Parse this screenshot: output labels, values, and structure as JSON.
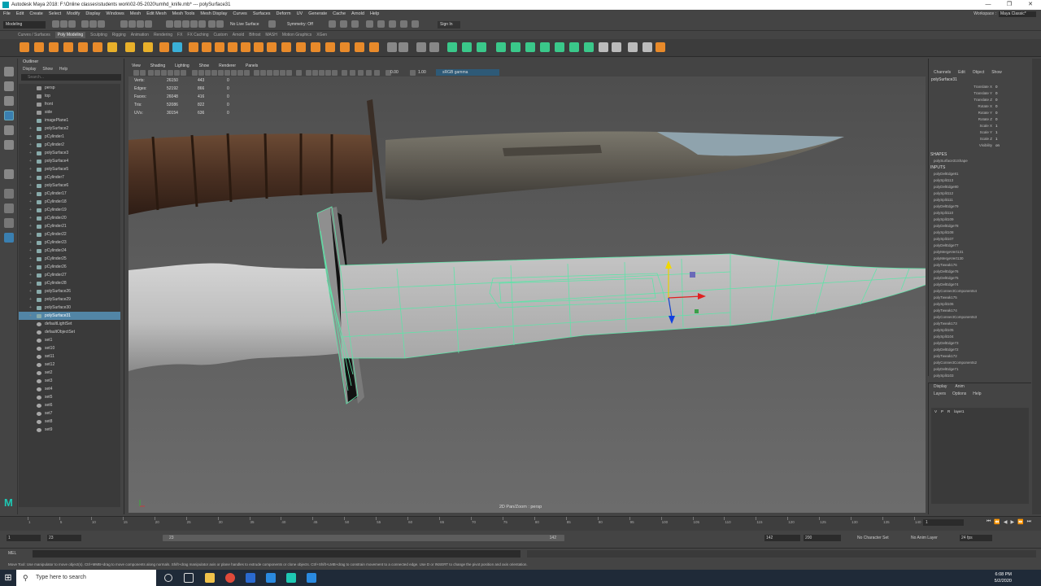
{
  "title_bar": {
    "text": "Autodesk Maya 2018: F:\\Online classes\\students work\\02-05-2020\\umhd_knife.mb* --- polySurface31",
    "buttons": [
      "—",
      "❐",
      "✕"
    ]
  },
  "menu": [
    "File",
    "Edit",
    "Create",
    "Select",
    "Modify",
    "Display",
    "Windows",
    "Mesh",
    "Edit Mesh",
    "Mesh Tools",
    "Mesh Display",
    "Curves",
    "Surfaces",
    "Deform",
    "UV",
    "Generate",
    "Cache",
    "Arnold",
    "Help"
  ],
  "workspace": {
    "label": "Workspace :",
    "value": "Maya Classic*"
  },
  "status_line": {
    "mode": "Modeling",
    "live_surface": "No Live Surface",
    "symmetry": "Symmetry: Off",
    "signin": "Sign In"
  },
  "shelf_tabs": [
    "Curves / Surfaces",
    "Poly Modeling",
    "Sculpting",
    "Rigging",
    "Animation",
    "Rendering",
    "FX",
    "FX Caching",
    "Custom",
    "Arnold",
    "Bifrost",
    "MASH",
    "Motion Graphics",
    "XGen"
  ],
  "shelf_active": "Poly Modeling",
  "outliner": {
    "title": "Outliner",
    "menu": [
      "Display",
      "Show",
      "Help"
    ],
    "search_placeholder": "Search...",
    "items": [
      {
        "label": "persp",
        "type": "cam"
      },
      {
        "label": "top",
        "type": "cam"
      },
      {
        "label": "front",
        "type": "cam"
      },
      {
        "label": "side",
        "type": "cam"
      },
      {
        "label": "imagePlane1",
        "type": "mesh"
      },
      {
        "label": "polySurface2",
        "type": "mesh"
      },
      {
        "label": "pCylinder1",
        "type": "mesh"
      },
      {
        "label": "pCylinder2",
        "type": "mesh"
      },
      {
        "label": "polySurface3",
        "type": "mesh"
      },
      {
        "label": "polySurface4",
        "type": "mesh"
      },
      {
        "label": "polySurface5",
        "type": "mesh"
      },
      {
        "label": "pCylinder7",
        "type": "mesh"
      },
      {
        "label": "polySurface6",
        "type": "mesh"
      },
      {
        "label": "pCylinder17",
        "type": "mesh"
      },
      {
        "label": "pCylinder18",
        "type": "mesh"
      },
      {
        "label": "pCylinder19",
        "type": "mesh"
      },
      {
        "label": "pCylinder20",
        "type": "mesh"
      },
      {
        "label": "pCylinder21",
        "type": "mesh"
      },
      {
        "label": "pCylinder22",
        "type": "mesh"
      },
      {
        "label": "pCylinder23",
        "type": "mesh"
      },
      {
        "label": "pCylinder24",
        "type": "mesh"
      },
      {
        "label": "pCylinder25",
        "type": "mesh"
      },
      {
        "label": "pCylinder26",
        "type": "mesh"
      },
      {
        "label": "pCylinder27",
        "type": "mesh"
      },
      {
        "label": "pCylinder28",
        "type": "mesh"
      },
      {
        "label": "polySurface26",
        "type": "mesh"
      },
      {
        "label": "polySurface29",
        "type": "mesh"
      },
      {
        "label": "polySurface30",
        "type": "mesh"
      },
      {
        "label": "polySurface31",
        "type": "mesh",
        "selected": true
      },
      {
        "label": "defaultLightSet",
        "type": "set"
      },
      {
        "label": "defaultObjectSet",
        "type": "set"
      },
      {
        "label": "set1",
        "type": "set"
      },
      {
        "label": "set10",
        "type": "set"
      },
      {
        "label": "set11",
        "type": "set"
      },
      {
        "label": "set12",
        "type": "set"
      },
      {
        "label": "set2",
        "type": "set"
      },
      {
        "label": "set3",
        "type": "set"
      },
      {
        "label": "set4",
        "type": "set"
      },
      {
        "label": "set5",
        "type": "set"
      },
      {
        "label": "set6",
        "type": "set"
      },
      {
        "label": "set7",
        "type": "set"
      },
      {
        "label": "set8",
        "type": "set"
      },
      {
        "label": "set9",
        "type": "set"
      }
    ]
  },
  "viewport": {
    "menu": [
      "View",
      "Shading",
      "Lighting",
      "Show",
      "Renderer",
      "Panels"
    ],
    "exposure": "0.00",
    "gamma": "1.00",
    "color_space": "sRGB gamma",
    "camera_label": "2D Pan/Zoom : persp",
    "hud": [
      {
        "label": "Verts:",
        "a": "26150",
        "b": "443",
        "c": "0"
      },
      {
        "label": "Edges:",
        "a": "52192",
        "b": "866",
        "c": "0"
      },
      {
        "label": "Faces:",
        "a": "26048",
        "b": "416",
        "c": "0"
      },
      {
        "label": "Tris:",
        "a": "52086",
        "b": "822",
        "c": "0"
      },
      {
        "label": "UVs:",
        "a": "30154",
        "b": "636",
        "c": "0"
      }
    ]
  },
  "channel_box": {
    "menu": [
      "Channels",
      "Edit",
      "Object",
      "Show"
    ],
    "object": "polySurface31",
    "attributes": [
      {
        "name": "Translate X",
        "value": "0"
      },
      {
        "name": "Translate Y",
        "value": "0"
      },
      {
        "name": "Translate Z",
        "value": "0"
      },
      {
        "name": "Rotate X",
        "value": "0"
      },
      {
        "name": "Rotate Y",
        "value": "0"
      },
      {
        "name": "Rotate Z",
        "value": "0"
      },
      {
        "name": "Scale X",
        "value": "1"
      },
      {
        "name": "Scale Y",
        "value": "1"
      },
      {
        "name": "Scale Z",
        "value": "1"
      },
      {
        "name": "Visibility",
        "value": "on"
      }
    ],
    "shapes_label": "SHAPES",
    "shape": "polySurface31Shape",
    "inputs_label": "INPUTS",
    "inputs": [
      "polyDelEdge81",
      "polySplit113",
      "polyDelEdge80",
      "polySplit112",
      "polySplit111",
      "polyDelEdge79",
      "polySplit110",
      "polySplit109",
      "polyDelEdge78",
      "polySplit108",
      "polySplit107",
      "polyDelEdge77",
      "polyMergeVert131",
      "polyMergeVert130",
      "polyTweak176",
      "polyDelEdge76",
      "polyDelEdge75",
      "polyDelEdge74",
      "polyConnectComponents4",
      "polyTweak175",
      "polySplit106",
      "polyTweak174",
      "polyConnectComponents3",
      "polyTweak173",
      "polySplit105",
      "polySplit104",
      "polyDelEdge73",
      "polyDelEdge72",
      "polyTweak172",
      "polyConnectComponents2",
      "polyDelEdge71",
      "polySplit103"
    ]
  },
  "layer_panel": {
    "tabs": [
      "Display",
      "Anim"
    ],
    "menu": [
      "Layers",
      "Options",
      "Help"
    ],
    "layers": [
      {
        "v": "V",
        "p": "P",
        "r": "R",
        "name": "layer1"
      }
    ]
  },
  "timeline": {
    "ticks": [
      "1",
      "5",
      "10",
      "15",
      "20",
      "25",
      "30",
      "35",
      "40",
      "45",
      "50",
      "55",
      "60",
      "65",
      "70",
      "75",
      "80",
      "85",
      "90",
      "95",
      "100",
      "105",
      "110",
      "115",
      "120",
      "125",
      "130",
      "135",
      "140"
    ],
    "current_frame": "1"
  },
  "range": {
    "start": "1",
    "playback_start": "23",
    "slider_start": "23",
    "slider_end": "142",
    "playback_end": "142",
    "end": "200",
    "character_set": "No Character Set",
    "anim_layer": "No Anim Layer",
    "fps": "24 fps"
  },
  "command_line": {
    "label": "MEL"
  },
  "help_line": "Move Tool: Use manipulator to move object(s). Ctrl+MMB+drag to move components along normals. Shift+drag manipulator axis or plane handles to extrude components or clone objects. Ctrl+Shift+LMB+drag to constrain movement to a connected edge. Use D or INSERT to change the pivot position and axis orientation.",
  "taskbar": {
    "search_placeholder": "Type here to search",
    "time": "6:08 PM",
    "date": "5/2/2020"
  },
  "colors": {
    "selection": "#5285a6",
    "wire": "#5fe3a8",
    "accent": "#00b1ff"
  }
}
